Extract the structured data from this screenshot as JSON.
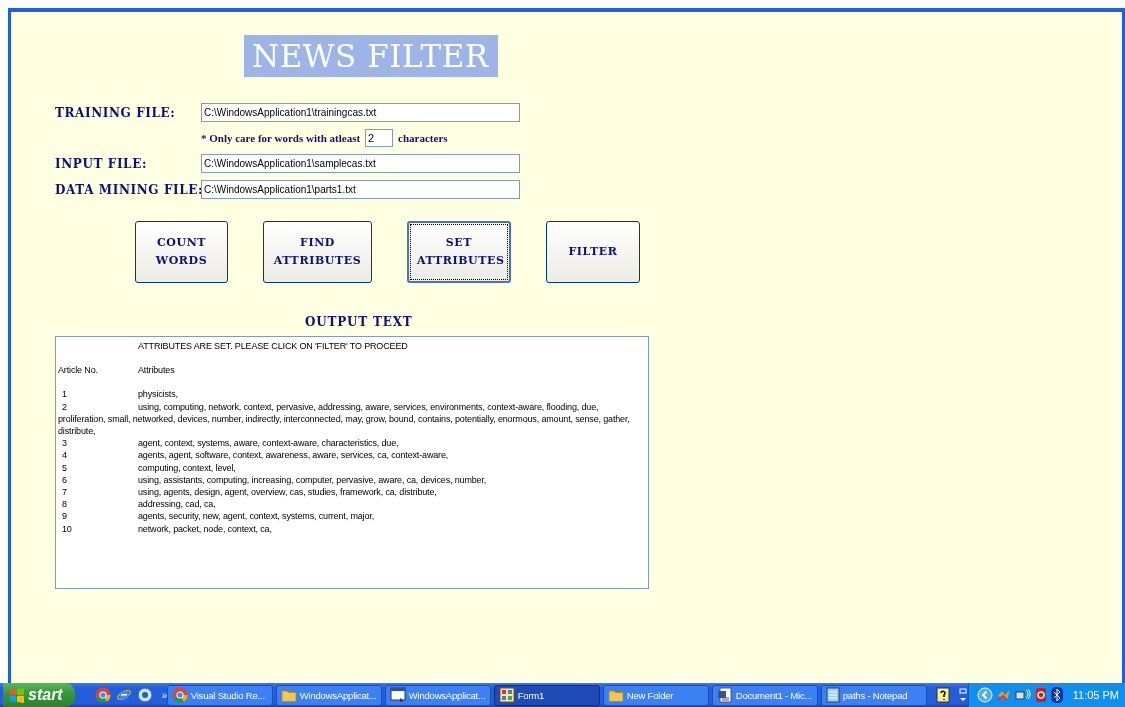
{
  "title": "NEWS FILTER",
  "form_rows": [
    {
      "kind": "file",
      "label": "TRAINING FILE:",
      "value": "C:\\WindowsApplication1\\trainingcas.txt"
    },
    {
      "kind": "note",
      "prefix": "* Only care for words with atleast",
      "value": "2",
      "suffix": "characters"
    },
    {
      "kind": "file",
      "label": "INPUT FILE:",
      "value": "C:\\WindowsApplication1\\samplecas.txt"
    },
    {
      "kind": "file",
      "label": "DATA MINING FILE:",
      "value": "C:\\WindowsApplication1\\parts1.txt"
    }
  ],
  "buttons": [
    {
      "label": "COUNT WORDS",
      "focused": false
    },
    {
      "label": "FIND ATTRIBUTES",
      "focused": false
    },
    {
      "label": "SET ATTRIBUTES",
      "focused": true
    },
    {
      "label": "FILTER",
      "focused": false
    }
  ],
  "output": {
    "label": "OUTPUT TEXT",
    "message": "ATTRIBUTES ARE SET. PLEASE CLICK ON 'FILTER' TO PROCEED",
    "columns": [
      "Article No.",
      "Attributes"
    ],
    "rows": [
      {
        "number": "1",
        "attributes": "physicists,"
      },
      {
        "number": "2",
        "attributes": "using, computing, network, context, pervasive, addressing, aware, services, environments, context-aware, flooding, due, proliferation, small, networked, devices, number, indirectly, interconnected, may, grow, bound, contains, potentially, enormous, amount, sense, gather, distribute,"
      },
      {
        "number": "3",
        "attributes": "agent, context, systems, aware, context-aware, characteristics, due,"
      },
      {
        "number": "4",
        "attributes": "agents, agent, software, context, awareness, aware, services, ca, context-aware,"
      },
      {
        "number": "5",
        "attributes": "computing, context, level,"
      },
      {
        "number": "6",
        "attributes": "using, assistants, computing, increasing, computer, pervasive, aware, ca, devices, number,"
      },
      {
        "number": "7",
        "attributes": "using, agents, design, agent, overview, cas, studies, framework, ca, distribute,"
      },
      {
        "number": "8",
        "attributes": "addressing, cad, ca,"
      },
      {
        "number": "9",
        "attributes": "agents, security, new, agent, context, systems, current, major,"
      },
      {
        "number": "10",
        "attributes": "network, packet, node, context, ca,"
      }
    ]
  },
  "taskbar": {
    "start": "start",
    "more": "»",
    "tasks": [
      {
        "kind": "browser",
        "label": "Visual Studio Re...",
        "selected": false
      },
      {
        "kind": "folder",
        "label": "WindowsApplicat...",
        "selected": false
      },
      {
        "kind": "editor",
        "label": "WindowsApplicat...",
        "selected": false
      },
      {
        "kind": "form",
        "label": "Form1",
        "selected": true
      },
      {
        "kind": "folder",
        "label": "New Folder",
        "selected": false
      },
      {
        "kind": "document",
        "label": "Document1 - Mic...",
        "selected": false
      },
      {
        "kind": "notepad",
        "label": "paths - Notepad",
        "selected": false
      }
    ],
    "clock": "11:05 PM"
  }
}
